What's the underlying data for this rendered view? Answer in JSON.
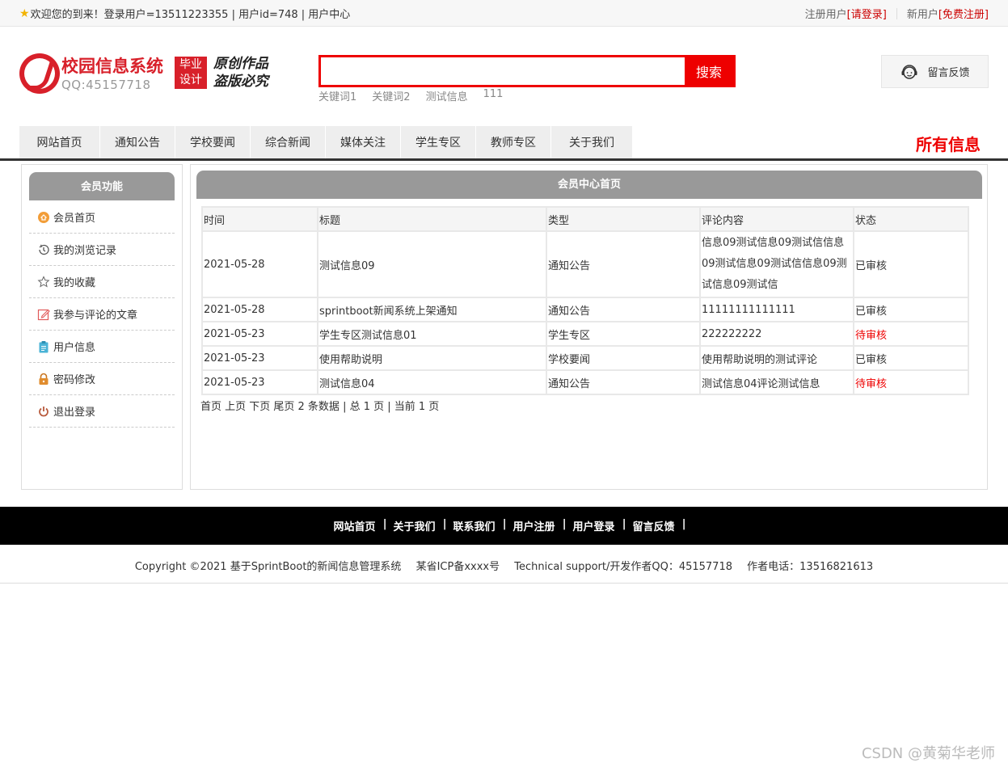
{
  "topbar": {
    "welcome_text": "欢迎您的到来！登录用户=13511223355 | 用户id=748 | 用户中心",
    "registered_label": "注册用户",
    "login_link": "[请登录]",
    "new_user_label": "新用户",
    "register_link": "[免费注册]"
  },
  "header": {
    "site_title": "校园信息系统",
    "qq": "QQ:45157718",
    "badge_line1": "毕业",
    "badge_line2": "设计",
    "slogan_line1": "原创作品",
    "slogan_line2": "盗版必究",
    "search_value": "",
    "search_button": "搜索",
    "keywords": [
      "关键词1",
      "关键词2",
      "测试信息",
      "111"
    ],
    "feedback_button": "留言反馈"
  },
  "nav": {
    "items": [
      "网站首页",
      "通知公告",
      "学校要闻",
      "综合新闻",
      "媒体关注",
      "学生专区",
      "教师专区",
      "关于我们"
    ],
    "all_info": "所有信息"
  },
  "sidebar": {
    "title": "会员功能",
    "items": [
      {
        "label": "会员首页",
        "icon": "home-icon"
      },
      {
        "label": "我的浏览记录",
        "icon": "history-icon"
      },
      {
        "label": "我的收藏",
        "icon": "star-icon"
      },
      {
        "label": "我参与评论的文章",
        "icon": "edit-icon"
      },
      {
        "label": "用户信息",
        "icon": "clipboard-icon"
      },
      {
        "label": "密码修改",
        "icon": "lock-icon"
      },
      {
        "label": "退出登录",
        "icon": "power-icon"
      }
    ]
  },
  "main": {
    "title": "会员中心首页",
    "columns": [
      "时间",
      "标题",
      "类型",
      "评论内容",
      "状态"
    ],
    "rows": [
      {
        "time": "2021-05-28",
        "title": "测试信息09",
        "type": "通知公告",
        "comment": "信息09测试信息09测试信信息09测试信息09测试信信息09测试信息09测试信",
        "status": "已审核",
        "pending": false
      },
      {
        "time": "2021-05-28",
        "title": "sprintboot新闻系统上架通知",
        "type": "通知公告",
        "comment": "11111111111111",
        "status": "已审核",
        "pending": false
      },
      {
        "time": "2021-05-23",
        "title": "学生专区测试信息01",
        "type": "学生专区",
        "comment": "222222222",
        "status": "待审核",
        "pending": true
      },
      {
        "time": "2021-05-23",
        "title": "使用帮助说明",
        "type": "学校要闻",
        "comment": "使用帮助说明的测试评论",
        "status": "已审核",
        "pending": false
      },
      {
        "time": "2021-05-23",
        "title": "测试信息04",
        "type": "通知公告",
        "comment": "测试信息04评论测试信息",
        "status": "待审核",
        "pending": true
      }
    ],
    "pager": "首页 上页 下页 尾页 2 条数据 | 总 1 页 | 当前 1 页"
  },
  "footer": {
    "links": [
      "网站首页",
      "关于我们",
      "联系我们",
      "用户注册",
      "用户登录",
      "留言反馈"
    ],
    "copyright": "Copyright ©2021 基于SprintBoot的新闻信息管理系统",
    "icp": "某省ICP备xxxx号",
    "support": "Technical support/开发作者QQ：45157718",
    "phone": "作者电话：13516821613"
  },
  "watermark": "CSDN @黄菊华老师",
  "colors": {
    "accent_red": "#e00000",
    "brand_red": "#d8202a",
    "header_gray": "#999999"
  }
}
